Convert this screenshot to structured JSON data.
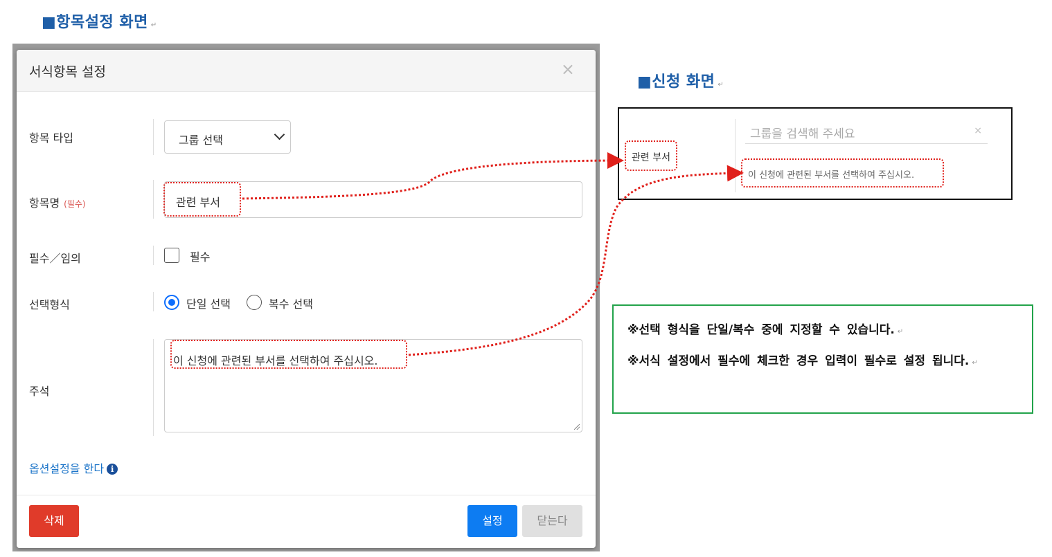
{
  "headings": {
    "setting_screen": "■항목설정 화면",
    "apply_screen": "■신청 화면",
    "return_mark": "↵"
  },
  "modal": {
    "title": "서식항목 설정",
    "close_symbol": "×",
    "fields": {
      "type_label": "항목 타입",
      "type_value": "그룹 선택",
      "name_label": "항목명",
      "name_required": "(필수)",
      "name_value": "관련 부서",
      "required_label": "필수／임의",
      "required_checkbox_label": "필수",
      "required_checked": false,
      "select_mode_label": "선택형식",
      "select_single": "단일 선택",
      "select_multi": "복수 선택",
      "select_single_checked": true,
      "note_label": "주석",
      "note_value": "이 신청에 관련된 부서를 선택하여 주십시오."
    },
    "option_link": "옵션설정을 한다",
    "info_icon": "i",
    "buttons": {
      "delete": "삭제",
      "set": "설정",
      "close": "닫는다"
    }
  },
  "preview": {
    "label": "관련 부서",
    "search_placeholder": "그룹을 검색해 주세요",
    "clear_symbol": "×",
    "help_text": "이 신청에 관련된 부서를 선택하여 주십시오."
  },
  "notes": [
    "※선택 형식을 단일/복수 중에 지정할 수 있습니다.",
    "※서식 설정에서 필수에 체크한 경우 입력이 필수로 설정 됩니다."
  ],
  "colors": {
    "heading": "#1f5fa8",
    "annotation": "#e0201b",
    "notes_border": "#22a34a",
    "primary": "#0d7cf2",
    "danger": "#e03b2a"
  }
}
